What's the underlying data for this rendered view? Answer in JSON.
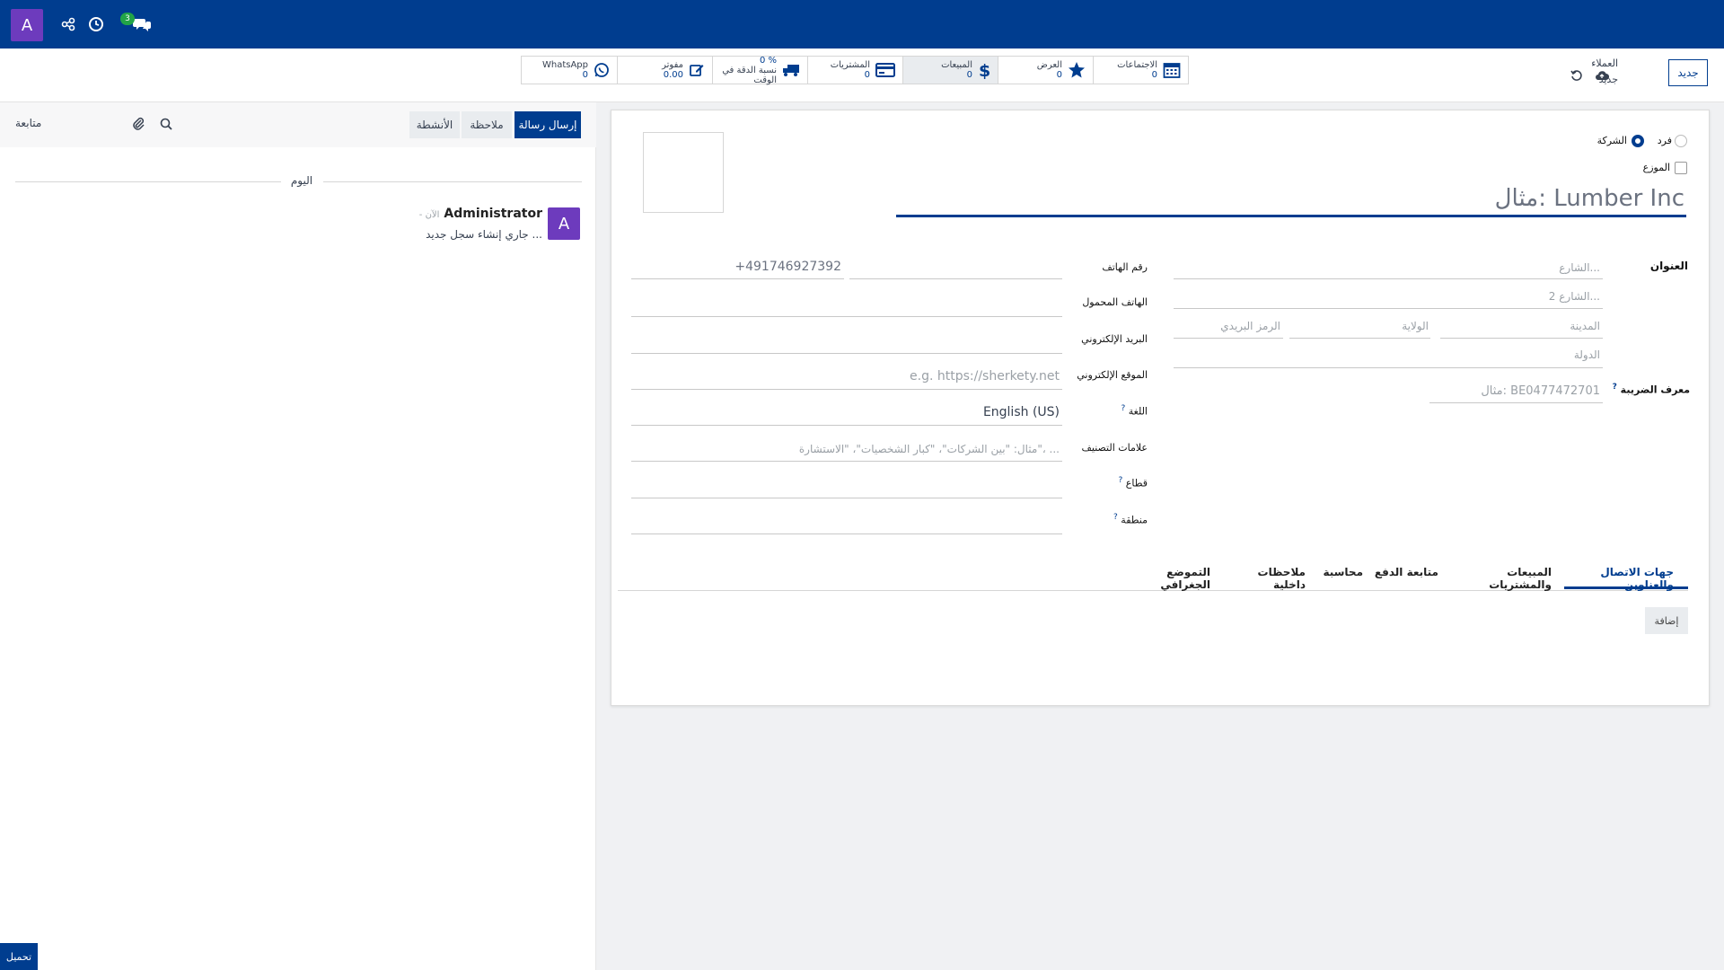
{
  "topbar": {
    "avatar_letter": "A",
    "chat_badge": "3"
  },
  "control_panel": {
    "new_button": "جديد",
    "breadcrumb_parent": "العملاء",
    "breadcrumb_current": "جديد",
    "stats": [
      {
        "icon": "whatsapp-icon",
        "label": "WhatsApp",
        "value": "0"
      },
      {
        "icon": "invoice-edit-icon",
        "label": "مفوتر",
        "value": "0.00"
      },
      {
        "icon": "truck-icon",
        "label": "نسبة الدقة في الوقت",
        "value": "0 %"
      },
      {
        "icon": "credit-card-icon",
        "label": "المشتريات",
        "value": "0"
      },
      {
        "icon": "dollar-icon",
        "label": "المبيعات",
        "value": "0"
      },
      {
        "icon": "star-icon",
        "label": "العرض",
        "value": "0"
      },
      {
        "icon": "calendar-icon",
        "label": "الاجتماعات",
        "value": "0"
      }
    ]
  },
  "chatter": {
    "send_message": "إرسال رسالة",
    "note": "ملاحظة",
    "activities": "الأنشطة",
    "follow": "متابعة",
    "today": "اليوم",
    "author": "Administrator",
    "time": "- الآن",
    "message": "جاري إنشاء سجل جديد ...",
    "avatar_letter": "A"
  },
  "form": {
    "type_individual": "فرد",
    "type_company": "الشركة",
    "distributor": "الموزع",
    "name_placeholder": "مثال: Lumber Inc",
    "address_label": "العنوان",
    "street_ph": "الشارع...",
    "street2_ph": "الشارع 2...",
    "city_ph": "المدينة",
    "state_ph": "الولاية",
    "zip_ph": "الرمز البريدي",
    "country_ph": "الدولة",
    "vat_label": "معرف الضريبة",
    "vat_ph": "مثال: BE0477472701",
    "phone_label": "رقم الهاتف",
    "phone_ph": "+491746927392",
    "mobile_label": "الهاتف المحمول",
    "email_label": "البريد الإلكتروني",
    "website_label": "الموقع الإلكتروني",
    "website_ph": "e.g. https://sherkety.net",
    "lang_label": "اللغة",
    "lang_value": "English (US)",
    "tags_label": "علامات التصنيف",
    "tags_ph": "مثال: \"بين الشركات\"، \"كبار الشخصيات\"، \"الاستشارة\"، ...",
    "sector_label": "قطاع",
    "region_label": "منطقة",
    "q": "?"
  },
  "tabs": [
    "جهات الاتصال والعناوين",
    "المبيعات والمشتريات",
    "متابعة الدفع",
    "محاسبة",
    "ملاحظات داخلية",
    "التموضع الجغرافي"
  ],
  "add_button": "إضافة",
  "download_button": "تحميل",
  "colors": {
    "primary": "#003d8f",
    "avatar": "#6d3bbd",
    "badge": "#22a447"
  }
}
